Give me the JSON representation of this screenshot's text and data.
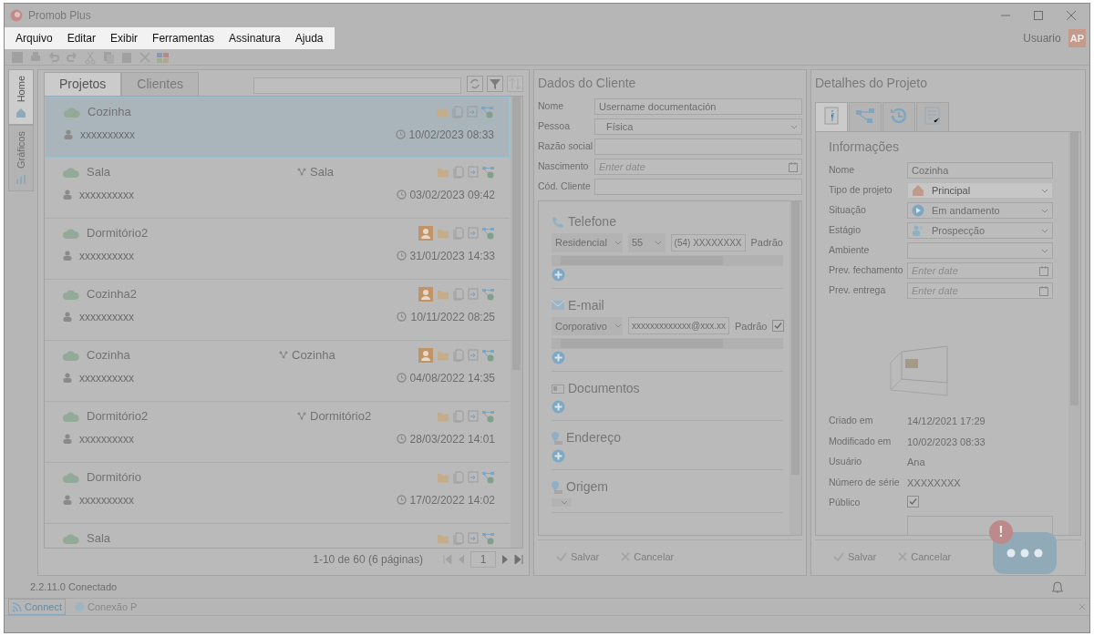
{
  "window": {
    "title": "Promob Plus",
    "user": "Usuario",
    "avatar": "AP"
  },
  "menu": [
    "Arquivo",
    "Editar",
    "Exibir",
    "Ferramentas",
    "Assinatura",
    "Ajuda"
  ],
  "side_tabs": [
    {
      "label": "Home",
      "selected": true
    },
    {
      "label": "Gráficos",
      "selected": false
    }
  ],
  "project_tabs": [
    {
      "label": "Projetos",
      "selected": true
    },
    {
      "label": "Clientes",
      "selected": false
    }
  ],
  "projects": [
    {
      "name": "Cozinha",
      "client": "xxxxxxxxxx",
      "date": "10/02/2023 08:33",
      "selected": true,
      "assigned": false
    },
    {
      "name": "Sala",
      "environment": "Sala",
      "client": "xxxxxxxxxx",
      "date": "03/02/2023 09:42",
      "selected": false,
      "assigned": false
    },
    {
      "name": "Dormitório2",
      "client": "xxxxxxxxxx",
      "date": "31/01/2023 14:33",
      "selected": false,
      "assigned": true
    },
    {
      "name": "Cozinha2",
      "client": "xxxxxxxxxx",
      "date": "10/11/2022 08:25",
      "selected": false,
      "assigned": true
    },
    {
      "name": "Cozinha",
      "environment": "Cozinha",
      "client": "xxxxxxxxxx",
      "date": "04/08/2022 14:35",
      "selected": false,
      "assigned": true
    },
    {
      "name": "Dormitório2",
      "environment": "Dormitório2",
      "client": "xxxxxxxxxx",
      "date": "28/03/2022 14:01",
      "selected": false,
      "assigned": false
    },
    {
      "name": "Dormitório",
      "client": "xxxxxxxxxx",
      "date": "17/02/2022 14:02",
      "selected": false,
      "assigned": false
    },
    {
      "name": "Sala",
      "selected": false,
      "assigned": false
    }
  ],
  "pagination": {
    "summary": "1-10 de 60 (6 páginas)",
    "page": "1"
  },
  "client": {
    "title": "Dados do Cliente",
    "fields": [
      {
        "label": "Nome",
        "kind": "text",
        "value": "Username documentación"
      },
      {
        "label": "Pessoa",
        "kind": "select",
        "value": "Física"
      },
      {
        "label": "Razão social",
        "kind": "text"
      },
      {
        "label": "Nascimento",
        "kind": "date",
        "placeholder": "Enter date"
      },
      {
        "label": "Cód. Cliente",
        "kind": "text"
      }
    ],
    "sections": [
      {
        "kind": "phone",
        "title": "Telefone",
        "type": "Residencial",
        "code": "55",
        "value": "(54) XXXXXXXX",
        "default_label": "Padrão"
      },
      {
        "kind": "email",
        "title": "E-mail",
        "type": "Corporativo",
        "value": "xxxxxxxxxxxxx@xxx.xx",
        "default_label": "Padrão",
        "checked": true
      },
      {
        "kind": "documents",
        "title": "Documentos"
      },
      {
        "kind": "address",
        "title": "Endereço"
      },
      {
        "kind": "origin",
        "title": "Origem"
      }
    ],
    "buttons": [
      {
        "label": "Salvar",
        "kind": "save",
        "disabled": true
      },
      {
        "label": "Cancelar",
        "kind": "cancel",
        "disabled": true
      }
    ]
  },
  "details": {
    "title": "Detalhes do Projeto",
    "tabs": [
      {
        "kind": "info",
        "selected": true
      },
      {
        "kind": "diagram",
        "selected": false
      },
      {
        "kind": "history",
        "selected": false
      },
      {
        "kind": "checklist",
        "selected": false
      }
    ],
    "section": "Informações",
    "fields": [
      {
        "label": "Nome",
        "kind": "text",
        "value": "Cozinha"
      },
      {
        "label": "Tipo de projeto",
        "kind": "select",
        "value": "Principal",
        "disabled": true
      },
      {
        "label": "Situação",
        "kind": "select",
        "value": "Em andamento",
        "disabled": false
      },
      {
        "label": "Estágio",
        "kind": "select",
        "value": "Prospecção",
        "disabled": false
      },
      {
        "label": "Ambiente",
        "kind": "select",
        "disabled": false
      },
      {
        "label": "Prev. fechamento",
        "kind": "date",
        "placeholder": "Enter date"
      },
      {
        "label": "Prev. entrega",
        "kind": "date",
        "placeholder": "Enter date"
      }
    ],
    "info": [
      {
        "label": "Criado em",
        "value": "14/12/2021 17:29"
      },
      {
        "label": "Modificado em",
        "value": "10/02/2023 08:33"
      },
      {
        "label": "Usuário",
        "value": "Ana"
      },
      {
        "label": "Número de série",
        "value": "XXXXXXXX"
      }
    ],
    "public": {
      "label": "Público",
      "checked": true
    },
    "buttons": [
      {
        "label": "Salvar",
        "kind": "save",
        "disabled": true
      },
      {
        "label": "Cancelar",
        "kind": "cancel",
        "disabled": true
      }
    ]
  },
  "chat": {
    "badge": "!"
  },
  "status": {
    "text": "2.2.11.0 Conectado"
  },
  "taskbar": [
    {
      "label": "Connect",
      "selected": true
    },
    {
      "label": "Conexão P",
      "selected": false
    }
  ]
}
